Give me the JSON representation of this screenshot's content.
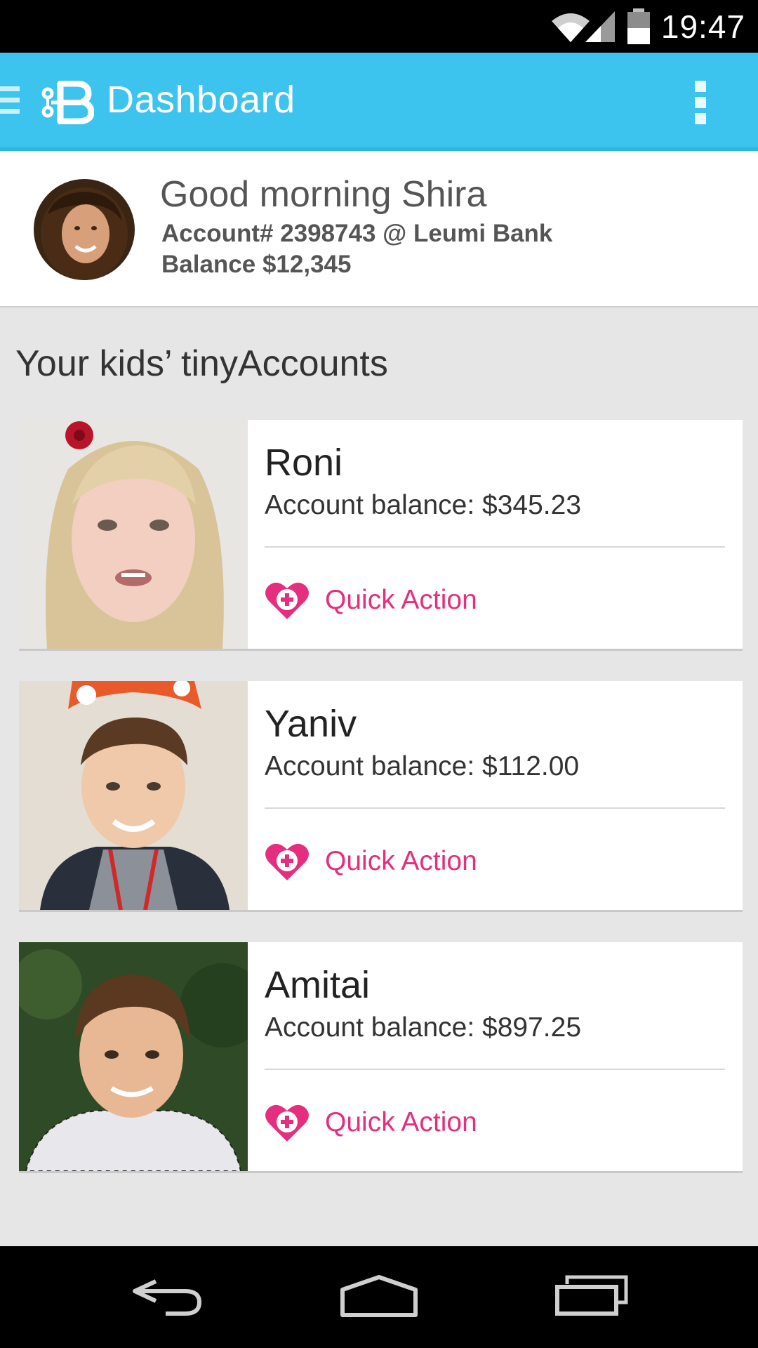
{
  "status_bar": {
    "time": "19:47",
    "icons": [
      "wifi-icon",
      "signal-icon",
      "battery-icon"
    ]
  },
  "app_bar": {
    "title": "Dashboard",
    "logo_icon": "tinybank-b-logo",
    "menu_icon": "overflow-menu-icon",
    "nav_icon": "drawer-indicator-icon",
    "color": "#3cc3ee"
  },
  "profile": {
    "greeting": "Good morning Shira",
    "account": "Account# 2398743 @ Leumi Bank",
    "balance": "Balance $12,345"
  },
  "section": {
    "title": "Your kids’ tinyAccounts"
  },
  "kids": [
    {
      "name": "Roni",
      "balance": "Account balance: $345.23",
      "action": "Quick Action"
    },
    {
      "name": "Yaniv",
      "balance": "Account balance: $112.00",
      "action": "Quick Action"
    },
    {
      "name": "Amitai",
      "balance": "Account balance: $897.25",
      "action": "Quick Action"
    }
  ],
  "accent_color": "#e62e7e",
  "nav_bar": {
    "icons": [
      "back-icon",
      "home-icon",
      "recent-apps-icon"
    ]
  }
}
